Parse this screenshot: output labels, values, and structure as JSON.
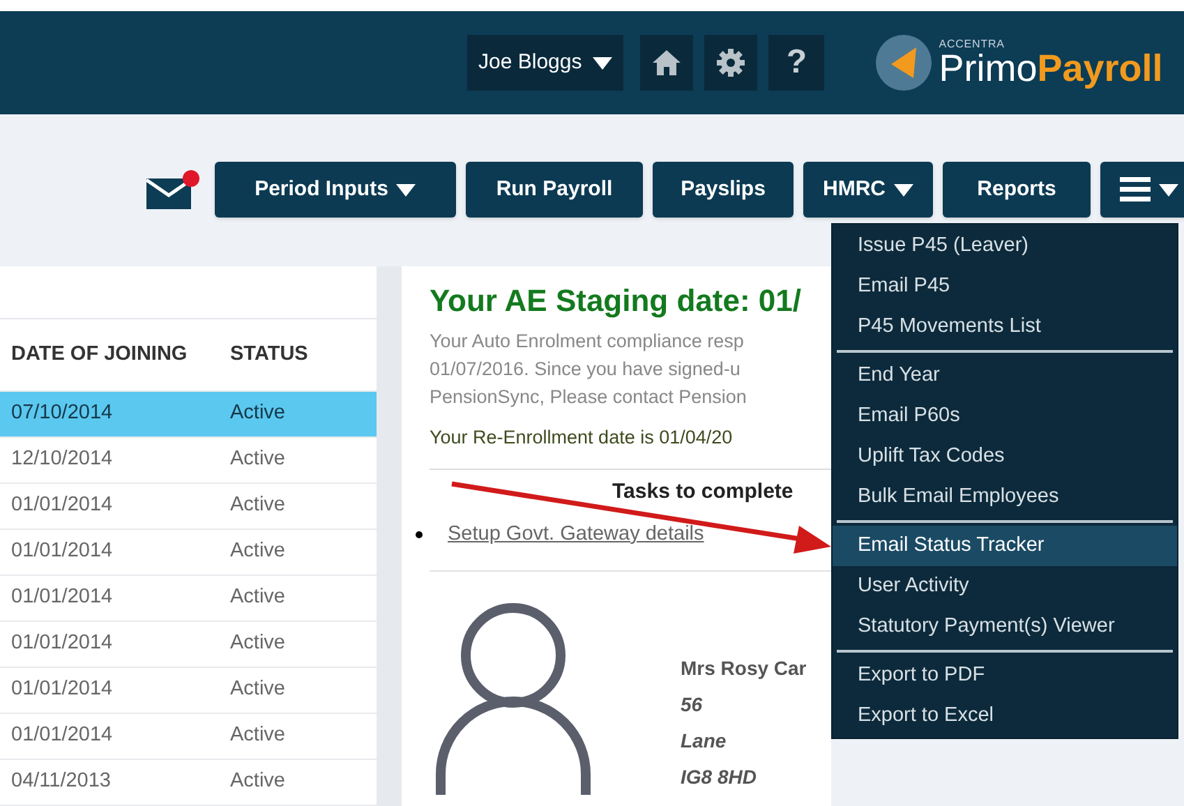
{
  "top_bar": {
    "user_menu": "Joe Bloggs",
    "help": "?",
    "logo": {
      "tagline": "ACCENTRA",
      "primary": "Primo",
      "accent": "Payroll"
    }
  },
  "nav_buttons": [
    {
      "kind": "text",
      "label": "Period Inputs",
      "dropdown": true
    },
    {
      "kind": "text",
      "label": "Run Payroll",
      "dropdown": false
    },
    {
      "kind": "text",
      "label": "Payslips",
      "dropdown": false
    },
    {
      "kind": "text",
      "label": "HMRC",
      "dropdown": true
    },
    {
      "kind": "text",
      "label": "Reports",
      "dropdown": false
    },
    {
      "kind": "menu",
      "dropdown": true
    }
  ],
  "employee_table": {
    "columns": [
      "DATE OF JOINING",
      "STATUS"
    ],
    "rows": [
      {
        "cells": [
          "07/10/2014",
          "Active"
        ],
        "selected": true
      },
      {
        "cells": [
          "12/10/2014",
          "Active"
        ],
        "selected": false
      },
      {
        "cells": [
          "01/01/2014",
          "Active"
        ],
        "selected": false
      },
      {
        "cells": [
          "01/01/2014",
          "Active"
        ],
        "selected": false
      },
      {
        "cells": [
          "01/01/2014",
          "Active"
        ],
        "selected": false
      },
      {
        "cells": [
          "01/01/2014",
          "Active"
        ],
        "selected": false
      },
      {
        "cells": [
          "01/01/2014",
          "Active"
        ],
        "selected": false
      },
      {
        "cells": [
          "01/01/2014",
          "Active"
        ],
        "selected": false
      },
      {
        "cells": [
          "04/11/2013",
          "Active"
        ],
        "selected": false
      }
    ]
  },
  "ae_card": {
    "title": "Your AE Staging date: 01/",
    "description": [
      "Your Auto Enrolment compliance resp",
      "01/07/2016. Since you have signed-u",
      "PensionSync, Please contact Pension"
    ],
    "re_enrollment": "Your Re-Enrollment date is 01/04/20",
    "tasks_heading": "Tasks to complete",
    "tasks": [
      "Setup Govt. Gateway details"
    ],
    "employee": {
      "name": "Mrs Rosy Car",
      "address": [
        "56",
        "Lane",
        "IG8 8HD"
      ]
    }
  },
  "hmrc_menu": {
    "groups": [
      [
        {
          "label": "Issue P45 (Leaver)",
          "selected": false
        },
        {
          "label": "Email P45",
          "selected": false
        },
        {
          "label": "P45 Movements List",
          "selected": false
        }
      ],
      [
        {
          "label": "End Year",
          "selected": false
        },
        {
          "label": "Email P60s",
          "selected": false
        },
        {
          "label": "Uplift Tax Codes",
          "selected": false
        },
        {
          "label": "Bulk Email Employees",
          "selected": false
        }
      ],
      [
        {
          "label": "Email Status Tracker",
          "selected": true
        },
        {
          "label": "User Activity",
          "selected": false
        },
        {
          "label": "Statutory Payment(s) Viewer",
          "selected": false
        }
      ],
      [
        {
          "label": "Export to PDF",
          "selected": false
        },
        {
          "label": "Export to Excel",
          "selected": false
        }
      ]
    ]
  }
}
